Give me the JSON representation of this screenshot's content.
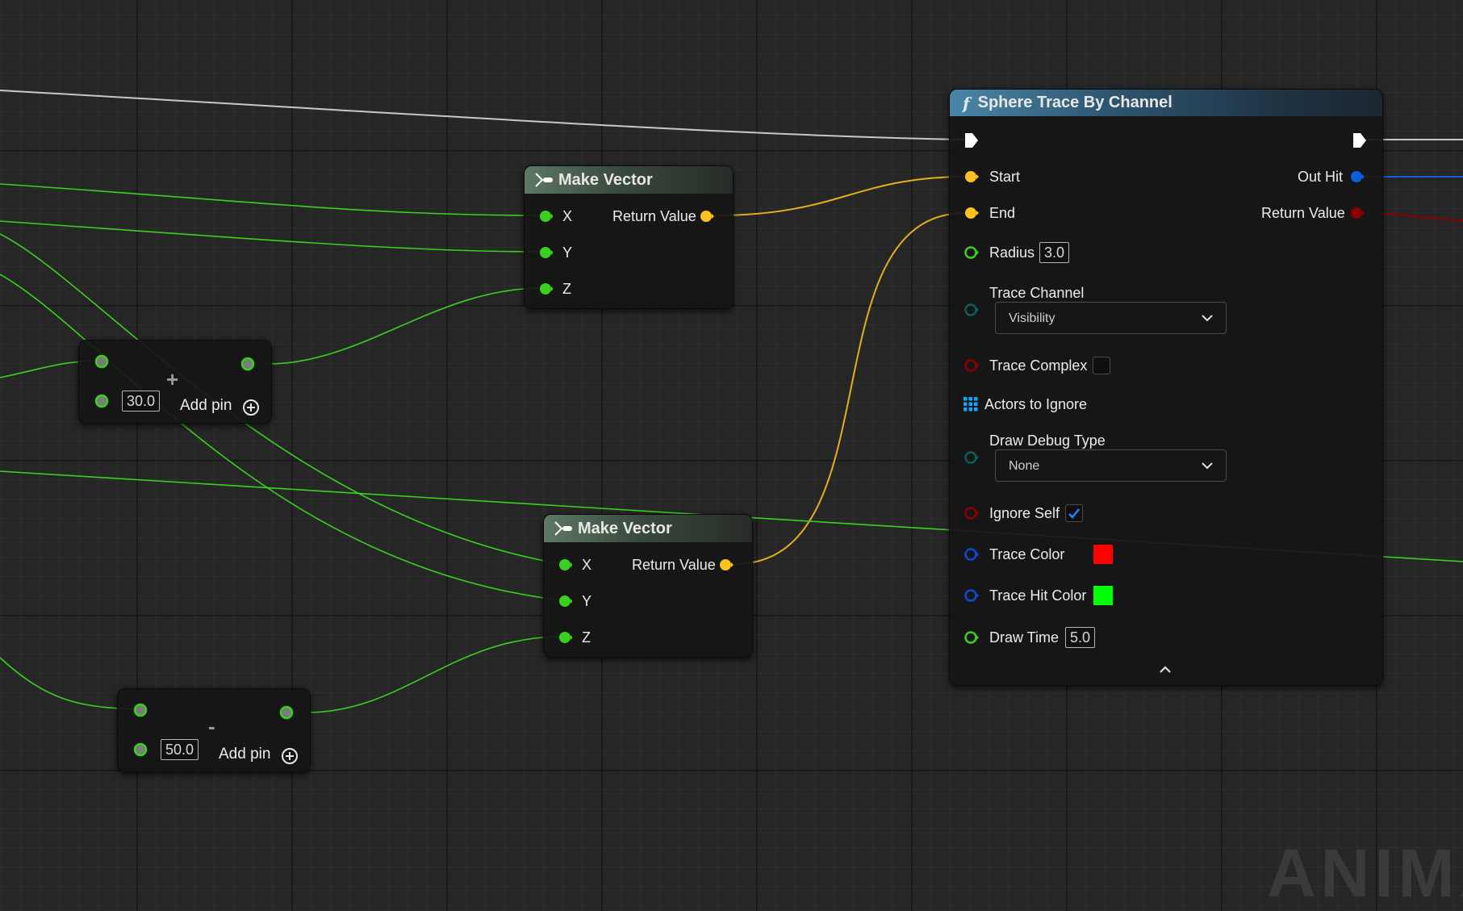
{
  "math_node_add": {
    "operator": "+",
    "input_b_value": "30.0",
    "add_pin_label": "Add pin"
  },
  "math_node_subtract": {
    "operator": "-",
    "input_b_value": "50.0",
    "add_pin_label": "Add pin"
  },
  "make_vector_1": {
    "title": "Make Vector",
    "pins": {
      "x": "X",
      "y": "Y",
      "z": "Z",
      "return_value": "Return Value"
    }
  },
  "make_vector_2": {
    "title": "Make Vector",
    "pins": {
      "x": "X",
      "y": "Y",
      "z": "Z",
      "return_value": "Return Value"
    }
  },
  "sphere_trace": {
    "title": "Sphere Trace By Channel",
    "function_icon": "f",
    "inputs": {
      "start": "Start",
      "end": "End",
      "radius": "Radius",
      "radius_value": "3.0",
      "trace_channel": "Trace Channel",
      "trace_channel_value": "Visibility",
      "trace_complex": "Trace Complex",
      "trace_complex_checked": false,
      "actors_to_ignore": "Actors to Ignore",
      "draw_debug_type": "Draw Debug Type",
      "draw_debug_type_value": "None",
      "ignore_self": "Ignore Self",
      "ignore_self_checked": true,
      "trace_color": "Trace Color",
      "trace_color_value": "#ff0000",
      "trace_hit_color": "Trace Hit Color",
      "trace_hit_color_value": "#00ff00",
      "draw_time": "Draw Time",
      "draw_time_value": "5.0"
    },
    "outputs": {
      "out_hit": "Out Hit",
      "return_value": "Return Value"
    }
  },
  "colors": {
    "float_pin": "#38d11e",
    "vector_pin": "#fdc21f",
    "struct_pin": "#0a60d8",
    "bool_pin": "#8e0000",
    "linear_color_pin": "#0a4ad8",
    "enum_pin": "#0b5f58",
    "object_pin": "#0ea5ff",
    "exec_pin": "#ffffff",
    "canvas_background": "#262626"
  },
  "watermark": "ANIMA"
}
